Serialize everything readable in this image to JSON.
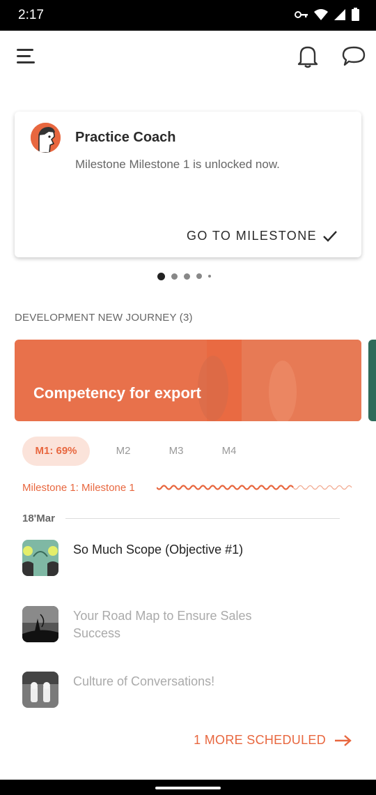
{
  "status_bar": {
    "time": "2:17"
  },
  "coach_card": {
    "title": "Practice Coach",
    "message": "Milestone Milestone 1 is unlocked now.",
    "cta": "GO TO MILESTONE"
  },
  "carousel": {
    "pages": 5,
    "current": 1
  },
  "section": {
    "label": "DEVELOPMENT NEW JOURNEY (3)"
  },
  "journey": {
    "title": "Competency for export"
  },
  "milestone_tabs": [
    {
      "label": "M1: 69%",
      "active": true
    },
    {
      "label": "M2",
      "active": false
    },
    {
      "label": "M3",
      "active": false
    },
    {
      "label": "M4",
      "active": false
    }
  ],
  "milestone": {
    "label": "Milestone 1: Milestone 1",
    "progress": 0.69
  },
  "date": "18'Mar",
  "lessons": [
    {
      "title": "So Much Scope (Objective #1)",
      "locked": false
    },
    {
      "title": "Your Road Map to Ensure Sales Success",
      "locked": true
    },
    {
      "title": "Culture of Conversations!",
      "locked": true
    }
  ],
  "more": {
    "label": "1 MORE SCHEDULED"
  },
  "colors": {
    "accent": "#e8673f",
    "accent_light": "#fbe3da",
    "card_orange": "#e8714b"
  }
}
